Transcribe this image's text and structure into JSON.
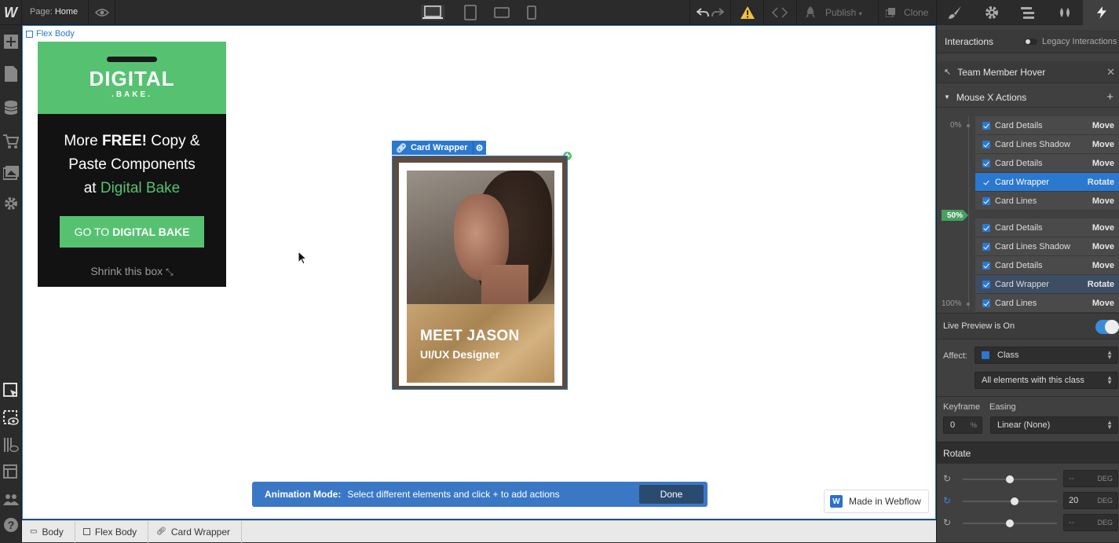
{
  "topbar": {
    "logo": "W",
    "page_prefix": "Page:",
    "page_name": "Home",
    "publish_label": "Publish",
    "clone_label": "Clone"
  },
  "canvas": {
    "flex_tag": "Flex Body",
    "ad": {
      "brand": "DIGITAL",
      "brand_sub": ".BAKE.",
      "headline_1": "More ",
      "headline_free": "FREE!",
      "headline_2": " Copy &",
      "headline_3": "Paste Components",
      "headline_4": "at ",
      "headline_brand": "Digital Bake",
      "button_pre": "GO TO",
      "button_bold": "DIGITAL BAKE",
      "shrink": "Shrink this box"
    },
    "card_tag": "Card Wrapper",
    "card_title": "MEET JASON",
    "card_role": "UI/UX Designer",
    "anim_label": "Animation Mode:",
    "anim_text": "Select different elements and click + to add actions",
    "anim_done": "Done",
    "made_in": "Made in Webflow"
  },
  "breadcrumbs": [
    "Body",
    "Flex Body",
    "Card Wrapper"
  ],
  "panel": {
    "interactions_title": "Interactions",
    "legacy_label": "Legacy Interactions",
    "trigger_name": "Team Member Hover",
    "actions_title": "Mouse X Actions",
    "pct_0": "0%",
    "pct_50": "50%",
    "pct_100": "100%",
    "group1": [
      {
        "name": "Card Details",
        "type": "Move"
      },
      {
        "name": "Card Lines Shadow",
        "type": "Move"
      },
      {
        "name": "Card Details",
        "type": "Move"
      },
      {
        "name": "Card Wrapper",
        "type": "Rotate"
      },
      {
        "name": "Card Lines",
        "type": "Move"
      }
    ],
    "group2": [
      {
        "name": "Card Details",
        "type": "Move"
      },
      {
        "name": "Card Lines Shadow",
        "type": "Move"
      },
      {
        "name": "Card Details",
        "type": "Move"
      },
      {
        "name": "Card Wrapper",
        "type": "Rotate"
      },
      {
        "name": "Card Lines",
        "type": "Move"
      }
    ],
    "live_preview": "Live Preview is On",
    "affect_label": "Affect:",
    "affect_value": "Class",
    "affect_scope": "All elements with this class",
    "keyframe_label": "Keyframe",
    "easing_label": "Easing",
    "keyframe_value": "0",
    "keyframe_unit": "%",
    "easing_value": "Linear (None)",
    "rotate_title": "Rotate",
    "rotate_x": "--",
    "rotate_y": "20",
    "rotate_z": "--",
    "deg_unit": "DEG"
  }
}
